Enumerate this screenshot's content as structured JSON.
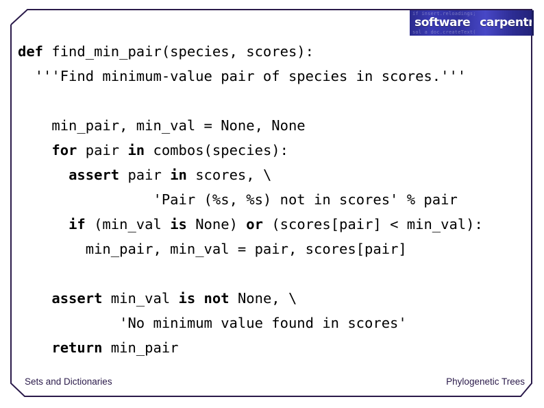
{
  "logo": {
    "name": "software-carpentry-logo",
    "word_1": "software",
    "word_2": "carpentry",
    "ghost_text_top": "if insert.reloadings;",
    "ghost_text_bottom": "sol a doc.createText(",
    "bg_color": "#3a3ab4",
    "text_color": "#ffffff"
  },
  "frame": {
    "border_color": "#2a1a4a"
  },
  "code": {
    "language": "python",
    "lines": [
      {
        "indent": 0,
        "segments": [
          {
            "text": "def ",
            "bold": true
          },
          {
            "text": "find_min_pair(species, scores):",
            "bold": false
          }
        ]
      },
      {
        "indent": 1,
        "segments": [
          {
            "text": "'''Find minimum-value pair of species in scores.'''",
            "bold": false
          }
        ]
      },
      {
        "indent": 0,
        "segments": []
      },
      {
        "indent": 2,
        "segments": [
          {
            "text": "min_pair, min_val = None, None",
            "bold": false
          }
        ]
      },
      {
        "indent": 2,
        "segments": [
          {
            "text": "for ",
            "bold": true
          },
          {
            "text": "pair ",
            "bold": false
          },
          {
            "text": "in ",
            "bold": true
          },
          {
            "text": "combos(species):",
            "bold": false
          }
        ]
      },
      {
        "indent": 3,
        "segments": [
          {
            "text": "assert ",
            "bold": true
          },
          {
            "text": "pair ",
            "bold": false
          },
          {
            "text": "in ",
            "bold": true
          },
          {
            "text": "scores, \\",
            "bold": false
          }
        ]
      },
      {
        "indent": 8,
        "segments": [
          {
            "text": "'Pair (%s, %s) not in scores' % pair",
            "bold": false
          }
        ]
      },
      {
        "indent": 3,
        "segments": [
          {
            "text": "if ",
            "bold": true
          },
          {
            "text": "(min_val ",
            "bold": false
          },
          {
            "text": "is ",
            "bold": true
          },
          {
            "text": "None) ",
            "bold": false
          },
          {
            "text": "or ",
            "bold": true
          },
          {
            "text": "(scores[pair] < min_val):",
            "bold": false
          }
        ]
      },
      {
        "indent": 4,
        "segments": [
          {
            "text": "min_pair, min_val = pair, scores[pair]",
            "bold": false
          }
        ]
      },
      {
        "indent": 0,
        "segments": []
      },
      {
        "indent": 2,
        "segments": [
          {
            "text": "assert ",
            "bold": true
          },
          {
            "text": "min_val ",
            "bold": false
          },
          {
            "text": "is not ",
            "bold": true
          },
          {
            "text": "None, \\",
            "bold": false
          }
        ]
      },
      {
        "indent": 6,
        "segments": [
          {
            "text": "'No minimum value found in scores'",
            "bold": false
          }
        ]
      },
      {
        "indent": 2,
        "segments": [
          {
            "text": "return ",
            "bold": true
          },
          {
            "text": "min_pair",
            "bold": false
          }
        ]
      }
    ]
  },
  "footer": {
    "left_label": "Sets and Dictionaries",
    "right_label": "Phylogenetic Trees",
    "text_color": "#2a1a4a"
  }
}
